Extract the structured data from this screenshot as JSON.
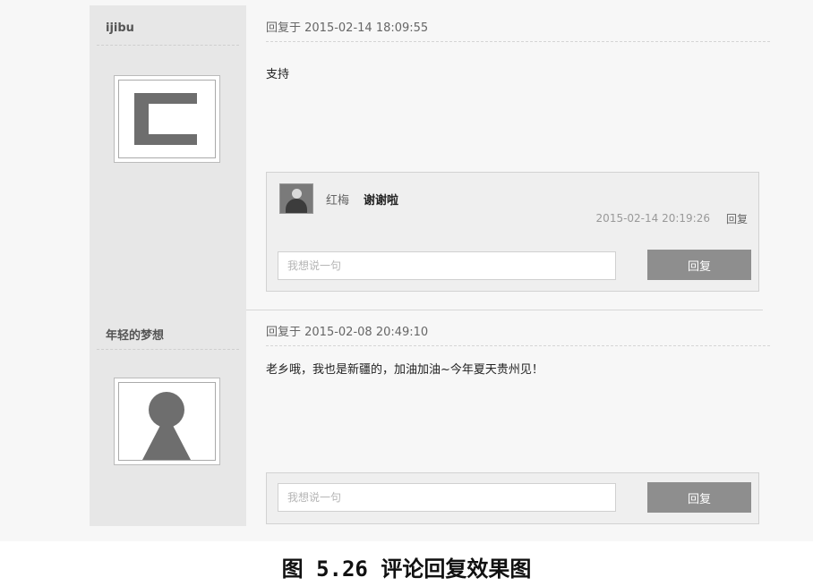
{
  "posts": [
    {
      "username": "ijibu",
      "avatar_icon": "letter-c-logo-icon",
      "reply_meta": "回复于 2015-02-14 18:09:55",
      "content": "支持",
      "sub_replies": [
        {
          "author": "红梅",
          "text": "谢谢啦",
          "time": "2015-02-14 20:19:26",
          "reply_link": "回复",
          "avatar_icon": "user-photo-icon"
        }
      ],
      "input_placeholder": "我想说一句",
      "button_label": "回复"
    },
    {
      "username": "年轻的梦想",
      "avatar_icon": "default-user-icon",
      "reply_meta": "回复于 2015-02-08 20:49:10",
      "content": "老乡哦，我也是新疆的，加油加油~今年夏天贵州见！",
      "sub_replies": [],
      "input_placeholder": "我想说一句",
      "button_label": "回复"
    }
  ],
  "caption": "图 5.26  评论回复效果图"
}
